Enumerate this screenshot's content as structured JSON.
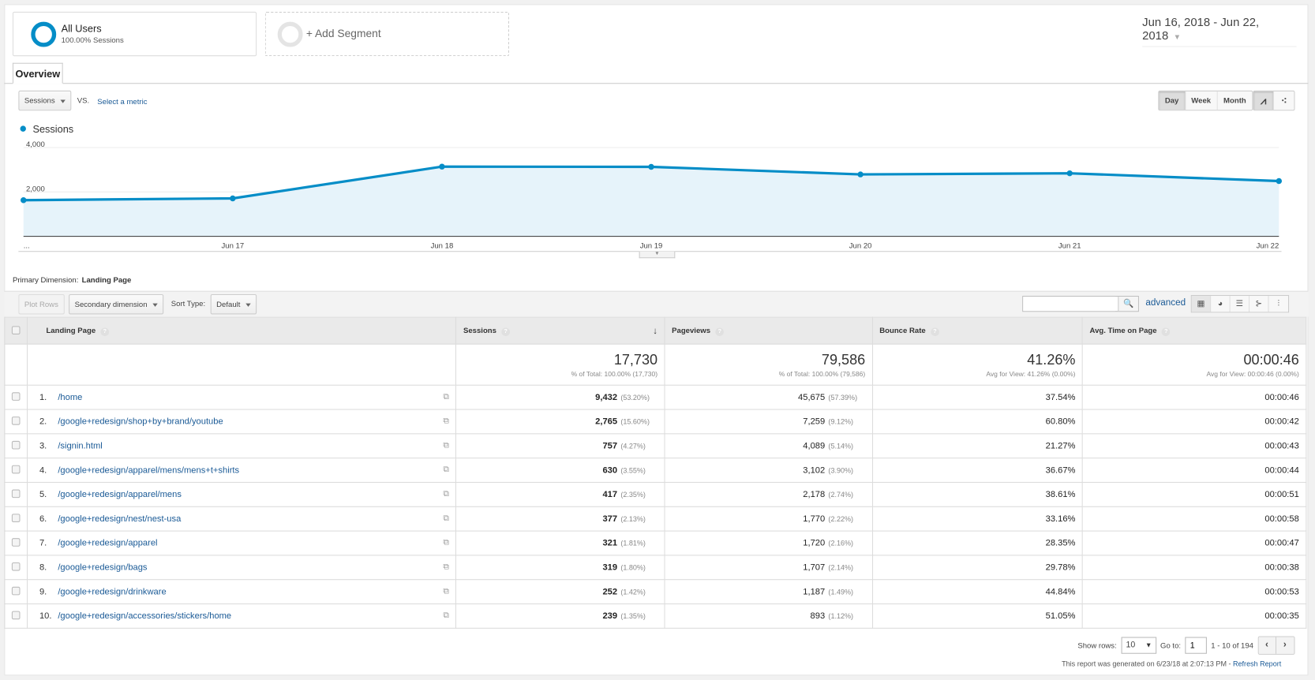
{
  "segments": {
    "all_users": {
      "title": "All Users",
      "subtitle": "100.00% Sessions"
    },
    "add_label": "+ Add Segment"
  },
  "date_range": "Jun 16, 2018 - Jun 22, 2018",
  "tabs": [
    {
      "label": "Overview"
    }
  ],
  "metric_selector": {
    "value": "Sessions",
    "vs": "VS.",
    "select_metric": "Select a metric"
  },
  "granularity": {
    "options": [
      "Day",
      "Week",
      "Month"
    ],
    "selected": "Day"
  },
  "chart_types": [
    "line-chart-icon",
    "motion-chart-icon"
  ],
  "colors": {
    "accent": "#058dc7",
    "fill": "#e6f3fa",
    "link": "#1a5a96"
  },
  "chart_data": {
    "type": "area",
    "series": [
      {
        "name": "Sessions",
        "values": [
          1630,
          1710,
          3140,
          3130,
          2790,
          2840,
          2490
        ]
      }
    ],
    "x": [
      "Jun 16",
      "Jun 17",
      "Jun 18",
      "Jun 19",
      "Jun 20",
      "Jun 21",
      "Jun 22"
    ],
    "x_tick_labels": [
      "...",
      "Jun 17",
      "Jun 18",
      "Jun 19",
      "Jun 20",
      "Jun 21",
      "Jun 22"
    ],
    "y_ticks": [
      "2,000",
      "4,000"
    ],
    "ylim": [
      0,
      4000
    ],
    "grid": true,
    "legend": "top-left"
  },
  "primary_dimension": {
    "label": "Primary Dimension:",
    "value": "Landing Page"
  },
  "toolbar": {
    "plot_rows": "Plot Rows",
    "secondary_dimension": "Secondary dimension",
    "sort_type_label": "Sort Type:",
    "sort_type": "Default",
    "search_placeholder": "",
    "advanced": "advanced",
    "views": [
      "table-view-icon",
      "pie-view-icon",
      "performance-view-icon",
      "comparison-view-icon",
      "pivot-view-icon"
    ]
  },
  "table": {
    "columns": [
      "Landing Page",
      "Sessions",
      "Pageviews",
      "Bounce Rate",
      "Avg. Time on Page"
    ],
    "totals": [
      {
        "value": "17,730",
        "sub": "% of Total: 100.00% (17,730)"
      },
      {
        "value": "79,586",
        "sub": "% of Total: 100.00% (79,586)"
      },
      {
        "value": "41.26%",
        "sub": "Avg for View: 41.26% (0.00%)"
      },
      {
        "value": "00:00:46",
        "sub": "Avg for View: 00:00:46 (0.00%)"
      }
    ],
    "rows": [
      {
        "idx": "1.",
        "page": "/home",
        "sessions": "9,432",
        "sessions_pct": "(53.20%)",
        "pageviews": "45,675",
        "pageviews_pct": "(57.39%)",
        "bounce": "37.54%",
        "time": "00:00:46"
      },
      {
        "idx": "2.",
        "page": "/google+redesign/shop+by+brand/youtube",
        "sessions": "2,765",
        "sessions_pct": "(15.60%)",
        "pageviews": "7,259",
        "pageviews_pct": "(9.12%)",
        "bounce": "60.80%",
        "time": "00:00:42"
      },
      {
        "idx": "3.",
        "page": "/signin.html",
        "sessions": "757",
        "sessions_pct": "(4.27%)",
        "pageviews": "4,089",
        "pageviews_pct": "(5.14%)",
        "bounce": "21.27%",
        "time": "00:00:43"
      },
      {
        "idx": "4.",
        "page": "/google+redesign/apparel/mens/mens+t+shirts",
        "sessions": "630",
        "sessions_pct": "(3.55%)",
        "pageviews": "3,102",
        "pageviews_pct": "(3.90%)",
        "bounce": "36.67%",
        "time": "00:00:44"
      },
      {
        "idx": "5.",
        "page": "/google+redesign/apparel/mens",
        "sessions": "417",
        "sessions_pct": "(2.35%)",
        "pageviews": "2,178",
        "pageviews_pct": "(2.74%)",
        "bounce": "38.61%",
        "time": "00:00:51"
      },
      {
        "idx": "6.",
        "page": "/google+redesign/nest/nest-usa",
        "sessions": "377",
        "sessions_pct": "(2.13%)",
        "pageviews": "1,770",
        "pageviews_pct": "(2.22%)",
        "bounce": "33.16%",
        "time": "00:00:58"
      },
      {
        "idx": "7.",
        "page": "/google+redesign/apparel",
        "sessions": "321",
        "sessions_pct": "(1.81%)",
        "pageviews": "1,720",
        "pageviews_pct": "(2.16%)",
        "bounce": "28.35%",
        "time": "00:00:47"
      },
      {
        "idx": "8.",
        "page": "/google+redesign/bags",
        "sessions": "319",
        "sessions_pct": "(1.80%)",
        "pageviews": "1,707",
        "pageviews_pct": "(2.14%)",
        "bounce": "29.78%",
        "time": "00:00:38"
      },
      {
        "idx": "9.",
        "page": "/google+redesign/drinkware",
        "sessions": "252",
        "sessions_pct": "(1.42%)",
        "pageviews": "1,187",
        "pageviews_pct": "(1.49%)",
        "bounce": "44.84%",
        "time": "00:00:53"
      },
      {
        "idx": "10.",
        "page": "/google+redesign/accessories/stickers/home",
        "sessions": "239",
        "sessions_pct": "(1.35%)",
        "pageviews": "893",
        "pageviews_pct": "(1.12%)",
        "bounce": "51.05%",
        "time": "00:00:35"
      }
    ]
  },
  "pagination": {
    "show_rows_label": "Show rows:",
    "show_rows": "10",
    "goto_label": "Go to:",
    "goto": "1",
    "range": "1 - 10 of 194"
  },
  "report_footer": {
    "generated": "This report was generated on 6/23/18 at 2:07:13 PM - ",
    "refresh": "Refresh Report"
  }
}
